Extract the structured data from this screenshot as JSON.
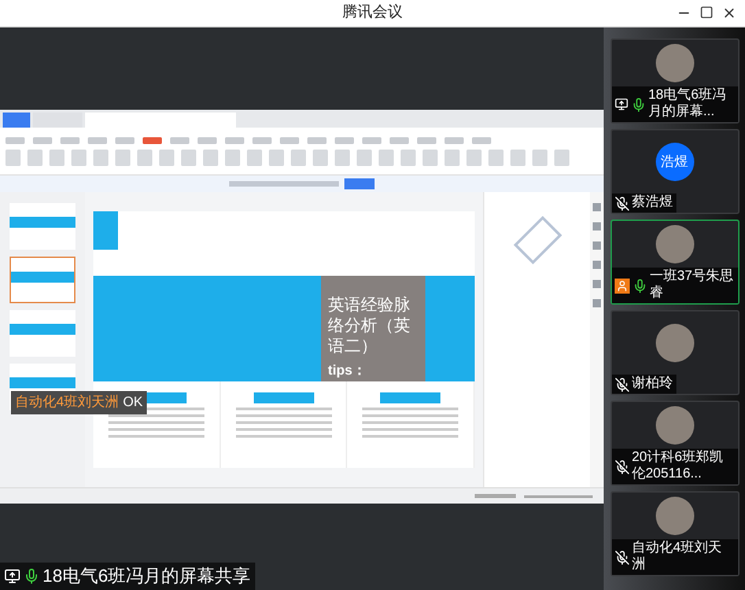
{
  "window": {
    "title": "腾讯会议"
  },
  "shared_screen": {
    "slide": {
      "title": "英语经验脉络分析（英语二）",
      "tips": "tips："
    },
    "notification": {
      "text": "自动化4班刘天洲",
      "action": "OK"
    }
  },
  "share_label": {
    "text": "18电气6班冯月的屏幕共享",
    "mic_muted": false
  },
  "participants": [
    {
      "name": "18电气6班冯月的屏幕...",
      "kind": "photo",
      "mic_muted": false,
      "sharing": true,
      "host": false,
      "selected": false
    },
    {
      "name": "蔡浩煜",
      "kind": "initial",
      "initial": "浩煜",
      "mic_muted": true,
      "sharing": false,
      "host": false,
      "selected": false
    },
    {
      "name": "一班37号朱思睿",
      "kind": "photo",
      "mic_muted": false,
      "sharing": false,
      "host": true,
      "selected": true
    },
    {
      "name": "谢柏玲",
      "kind": "photo",
      "mic_muted": true,
      "sharing": false,
      "host": false,
      "selected": false
    },
    {
      "name": "20计科6班郑凯伦205116...",
      "kind": "photo",
      "mic_muted": true,
      "sharing": false,
      "host": false,
      "selected": false
    },
    {
      "name": "自动化4班刘天洲",
      "kind": "photo",
      "mic_muted": true,
      "sharing": false,
      "host": false,
      "selected": false
    }
  ]
}
